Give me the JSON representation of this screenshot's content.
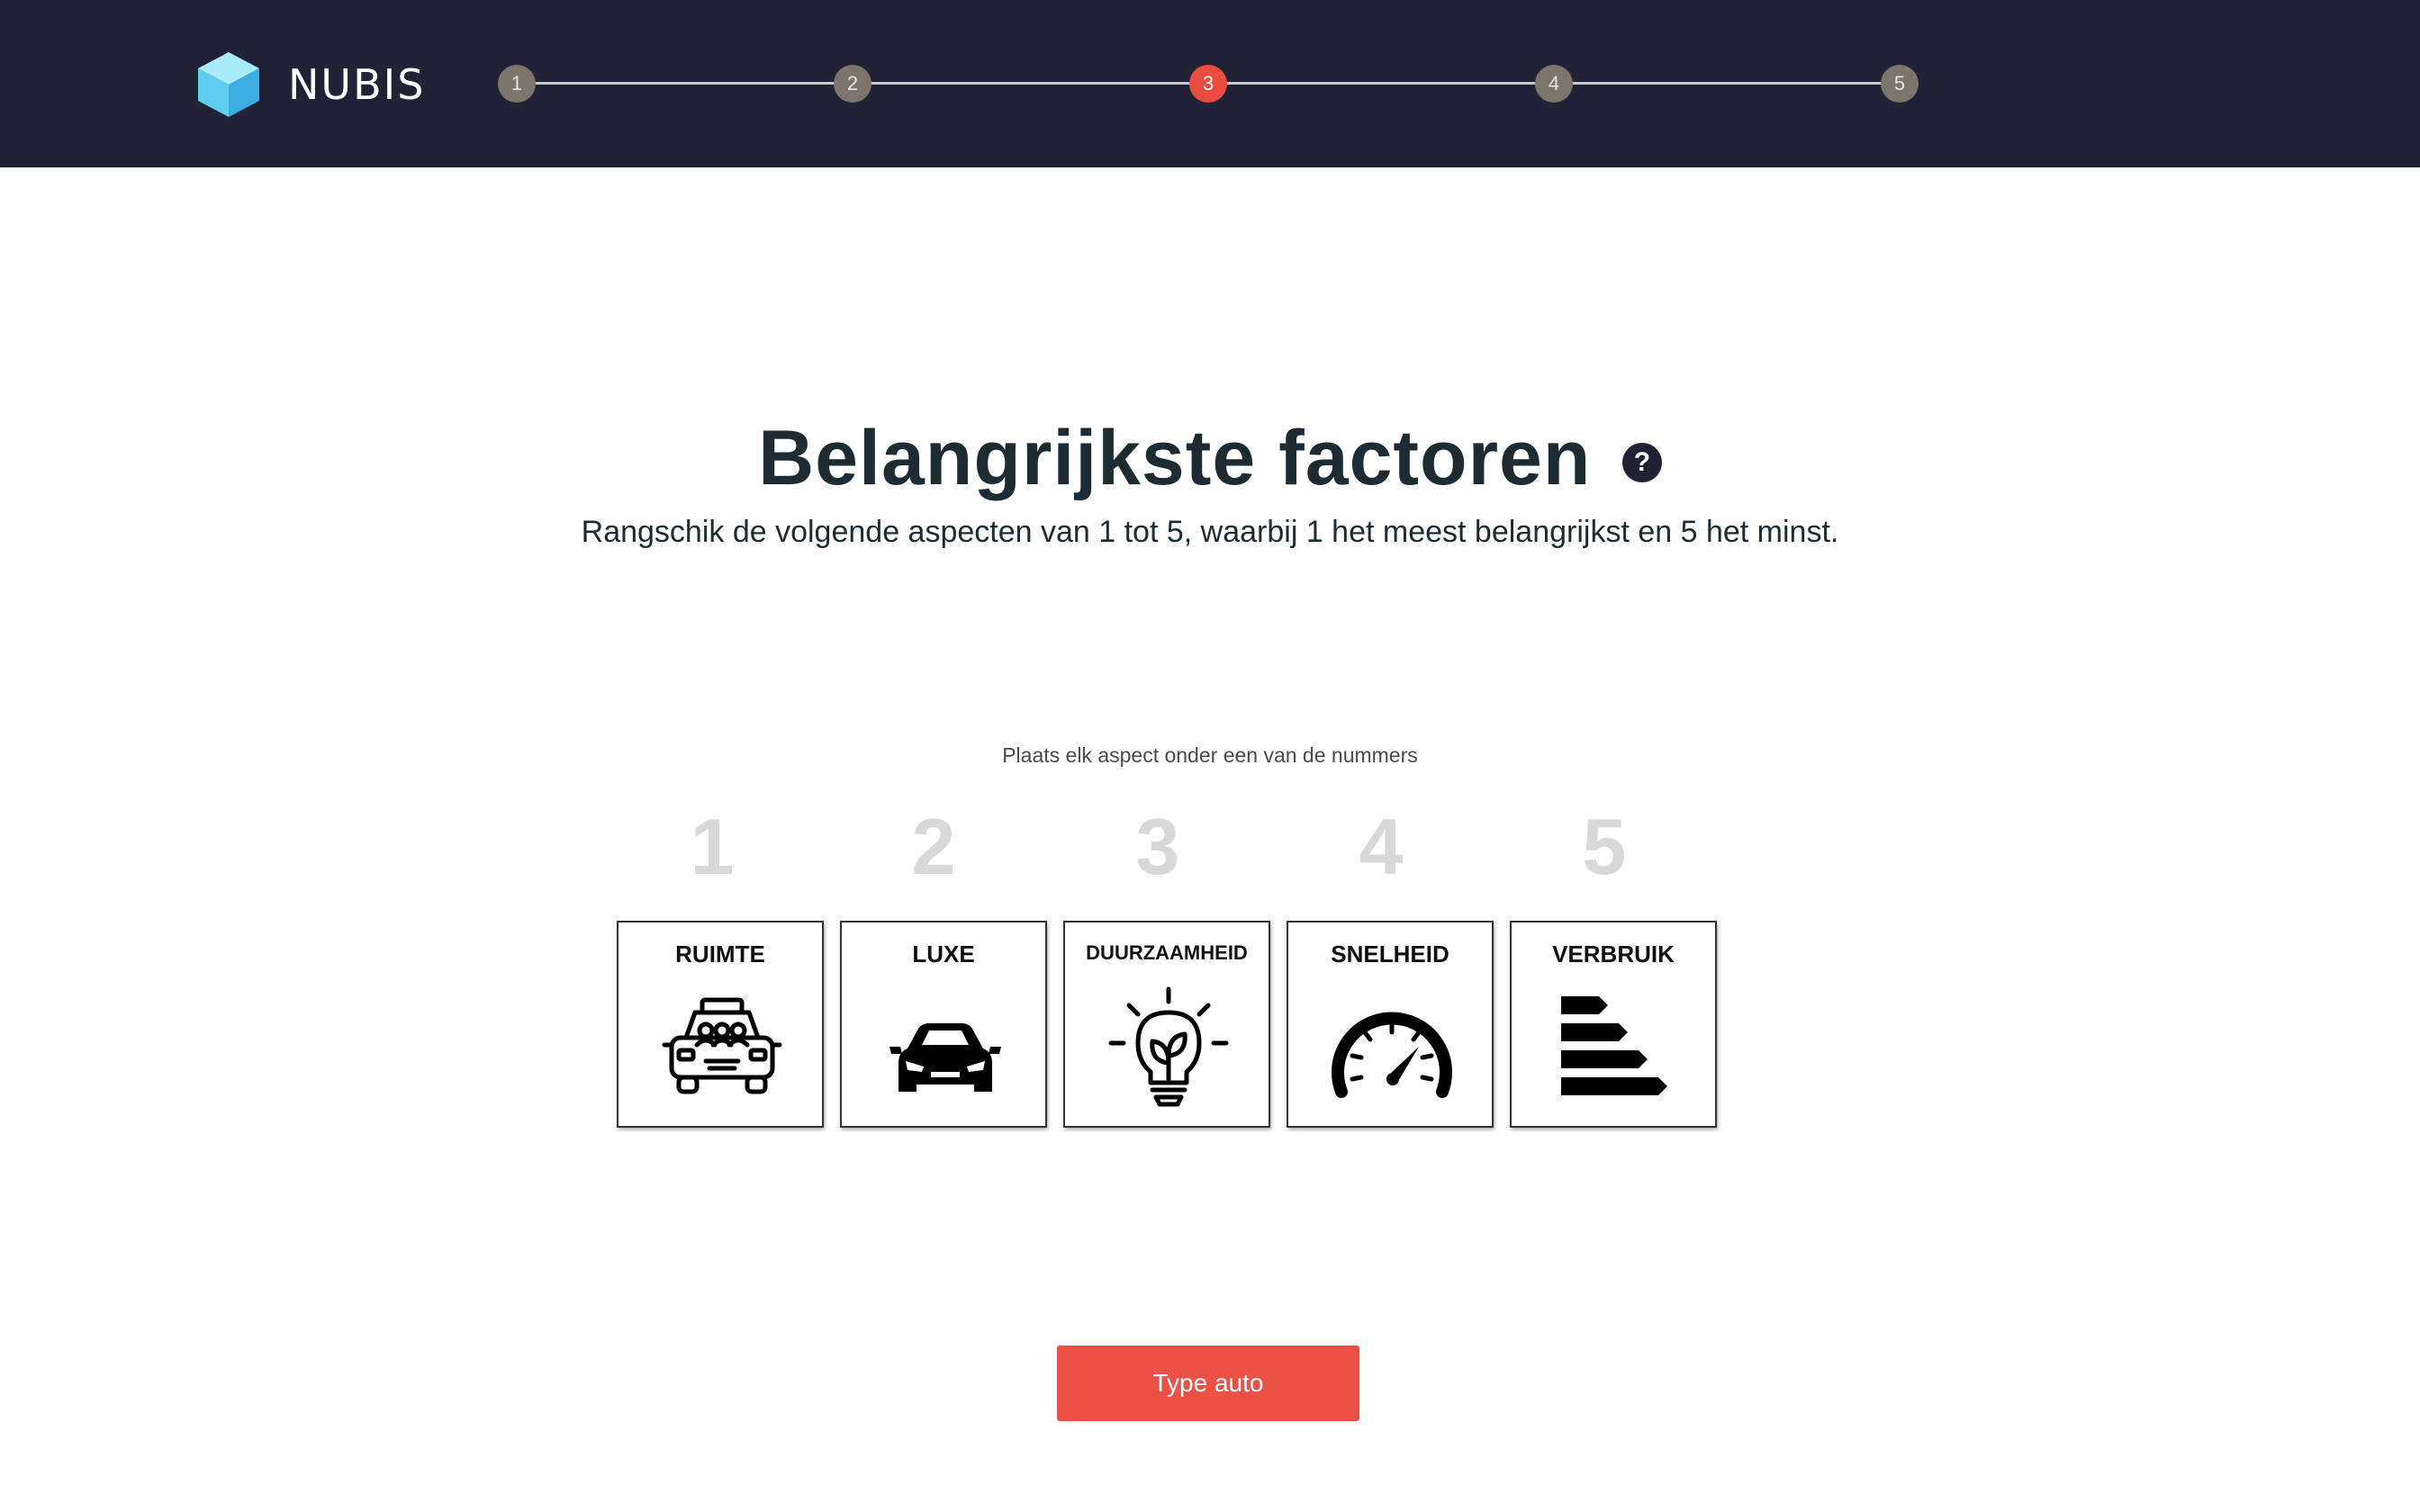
{
  "header": {
    "logo_text": "NUBIS",
    "steps": [
      "1",
      "2",
      "3",
      "4",
      "5"
    ],
    "active_step": 3
  },
  "main": {
    "title": "Belangrijkste factoren",
    "help_icon": "?",
    "subtitle": "Rangschik de volgende aspecten van 1 tot 5, waarbij 1 het meest belangrijkst en 5 het minst.",
    "instruction": "Plaats elk aspect onder een van de nummers",
    "ranks": [
      "1",
      "2",
      "3",
      "4",
      "5"
    ],
    "aspects": [
      {
        "label": "RUIMTE",
        "icon": "taxi-passengers-icon"
      },
      {
        "label": "LUXE",
        "icon": "sports-car-icon"
      },
      {
        "label": "DUURZAAMHEID",
        "icon": "eco-lightbulb-icon"
      },
      {
        "label": "SNELHEID",
        "icon": "speedometer-icon"
      },
      {
        "label": "VERBRUIK",
        "icon": "energy-label-icon"
      }
    ]
  },
  "footer": {
    "next_button": "Type auto"
  },
  "colors": {
    "header_bg": "#1f2335",
    "accent": "#eb4c40",
    "step_inactive": "#7d746c",
    "title": "#1d2b33",
    "rank_number": "#d8d8d8"
  }
}
